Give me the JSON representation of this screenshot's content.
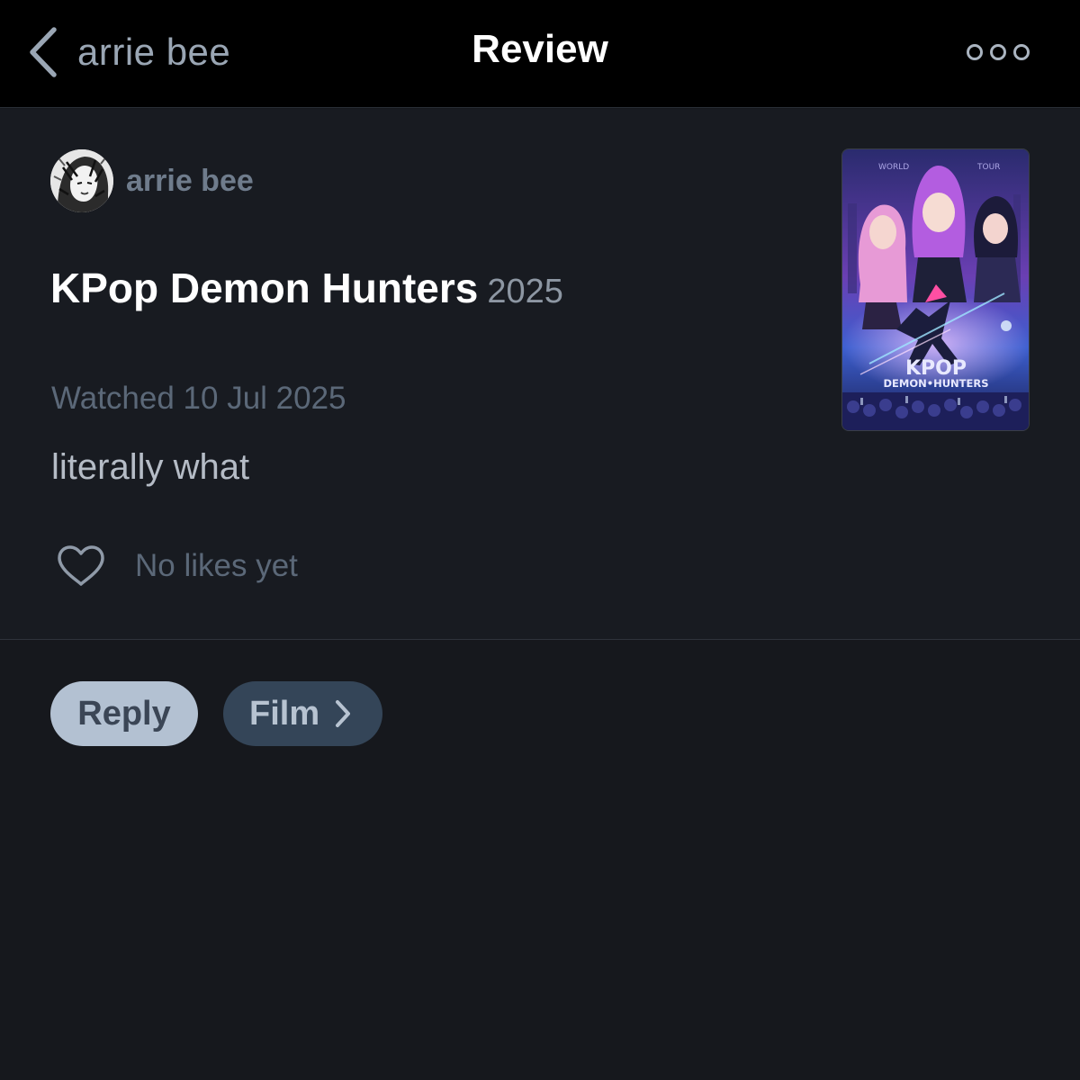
{
  "navbar": {
    "back_label": "arrie bee",
    "title": "Review"
  },
  "review": {
    "author_name": "arrie bee",
    "film_title": "KPop Demon Hunters",
    "film_year": "2025",
    "watched": "Watched 10 Jul 2025",
    "text": "literally what",
    "likes_label": "No likes yet"
  },
  "poster": {
    "title_line1": "KPOP",
    "title_line2": "DEMON•HUNTERS",
    "banner_left": "WORLD",
    "banner_right": "TOUR"
  },
  "actions": {
    "reply_label": "Reply",
    "film_label": "Film"
  },
  "icons": {
    "back": "chevron-left-icon",
    "more": "ellipsis-icon",
    "like": "heart-icon",
    "film_arrow": "chevron-right-icon"
  },
  "colors": {
    "background": "#16181d",
    "navbar": "#000000",
    "reply_button": "#b3c1d2",
    "film_button": "#344558"
  }
}
